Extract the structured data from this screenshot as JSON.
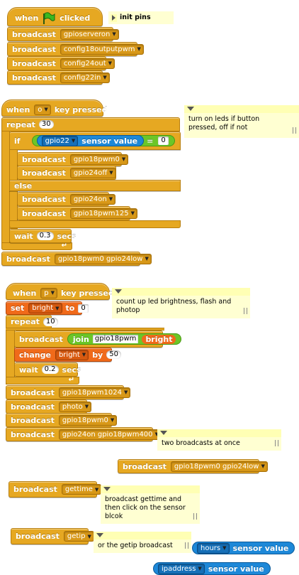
{
  "colors": {
    "control": "#e6a822",
    "variables": "#f06a1a",
    "operators": "#6cc628",
    "sensing": "#1d88d8",
    "note_bg": "#ffffd2"
  },
  "script1": {
    "hat_when": "when",
    "hat_clicked": "clicked",
    "flag_icon": "green-flag-icon",
    "broadcast_label": "broadcast",
    "broadcasts": [
      "gpioserveron",
      "config18outputpwm",
      "config24out",
      "config22in"
    ],
    "note_collapsed": "init pins"
  },
  "script2": {
    "when_label": "when",
    "key": "o",
    "key_pressed": "key pressed",
    "repeat_label": "repeat",
    "repeat_count": "30",
    "if_label": "if",
    "sensor": "gpio22",
    "sensor_value_label": "sensor value",
    "equals": "=",
    "compare_value": "0",
    "broadcast_label": "broadcast",
    "if_broadcasts": [
      "gpio18pwm0",
      "gpio24off"
    ],
    "else_label": "else",
    "else_broadcasts": [
      "gpio24on",
      "gpio18pwm125"
    ],
    "wait_label": "wait",
    "wait_value": "0.3",
    "secs_label": "secs",
    "final_broadcast": "gpio18pwm0 gpio24low",
    "note": "turn on leds if button\npressed, off if not"
  },
  "script3": {
    "when_label": "when",
    "key": "p",
    "key_pressed": "key pressed",
    "set_label": "set",
    "set_var": "bright",
    "to_label": "to",
    "set_value": "0",
    "repeat_label": "repeat",
    "repeat_count": "10",
    "broadcast_label": "broadcast",
    "join_label": "join",
    "join_text": "gpio18pwm",
    "join_var": "bright",
    "change_label": "change",
    "change_var": "bright",
    "by_label": "by",
    "change_value": "50",
    "wait_label": "wait",
    "wait_value": "0.2",
    "secs_label": "secs",
    "after_broadcasts": [
      "gpio18pwm1024",
      "photo",
      "gpio18pwm0",
      "gpio24on gpio18pwm400"
    ],
    "note": "count up led brightness, flash and\nphotop",
    "note2": "two broadcasts at once"
  },
  "loose": {
    "broadcast_label": "broadcast",
    "b1": "gpio18pwm0 gpio24low",
    "b2": "gettime",
    "b3": "getip",
    "note_gettime": "broadcast gettime and\nthen click on the sensor\nblcok",
    "note_getip": "or the getip broadcast",
    "sensor1": "hours",
    "sensor2": "ipaddress",
    "sensor_value_label": "sensor value"
  }
}
